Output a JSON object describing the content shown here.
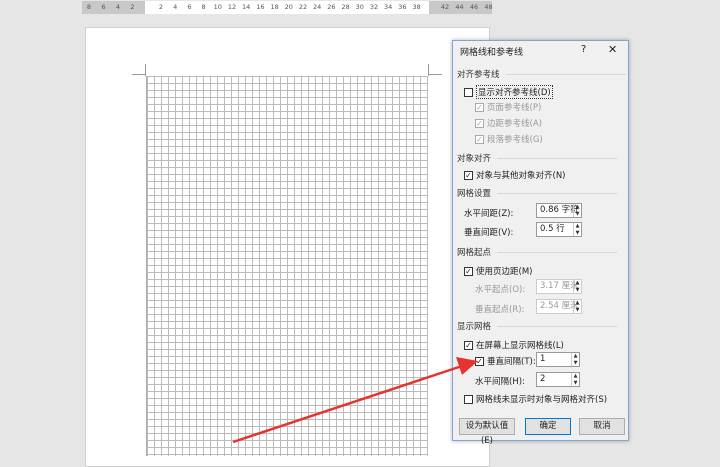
{
  "ruler": {
    "left": [
      "8",
      "6",
      "4",
      "2"
    ],
    "mid": [
      "2",
      "4",
      "6",
      "8",
      "10",
      "12",
      "14",
      "16",
      "18",
      "20",
      "22",
      "24",
      "26",
      "28",
      "30",
      "32",
      "34",
      "36",
      "38"
    ],
    "right": [
      "42",
      "44",
      "46",
      "48"
    ]
  },
  "dialog": {
    "title": "网格线和参考线",
    "help": "?",
    "close": "✕",
    "sec_align": "对齐参考线",
    "show_guides": "显示对齐参考线(D)",
    "page_guides": "页面参考线(P)",
    "margin_guides": "边距参考线(A)",
    "para_guides": "段落参考线(G)",
    "sec_obj": "对象对齐",
    "obj_align": "对象与其他对象对齐(N)",
    "sec_grid": "网格设置",
    "h_spacing_label": "水平间距(Z):",
    "h_spacing": "0.86 字符",
    "v_spacing_label": "垂直间距(V):",
    "v_spacing": "0.5 行",
    "sec_origin": "网格起点",
    "use_margin": "使用页边距(M)",
    "h_origin_label": "水平起点(O):",
    "h_origin": "3.17 厘米",
    "v_origin_label": "垂直起点(R):",
    "v_origin": "2.54 厘米",
    "sec_show": "显示网格",
    "show_grid": "在屏幕上显示网格线(L)",
    "v_interval_label": "垂直间隔(T):",
    "v_interval": "1",
    "h_interval_label": "水平间隔(H):",
    "h_interval": "2",
    "snap_hidden": "网格线未显示时对象与网格对齐(S)",
    "default_btn": "设为默认值(E)",
    "ok_btn": "确定",
    "cancel_btn": "取消"
  },
  "colors": {
    "arrow": "#e8322f",
    "accent": "#0078d7"
  }
}
